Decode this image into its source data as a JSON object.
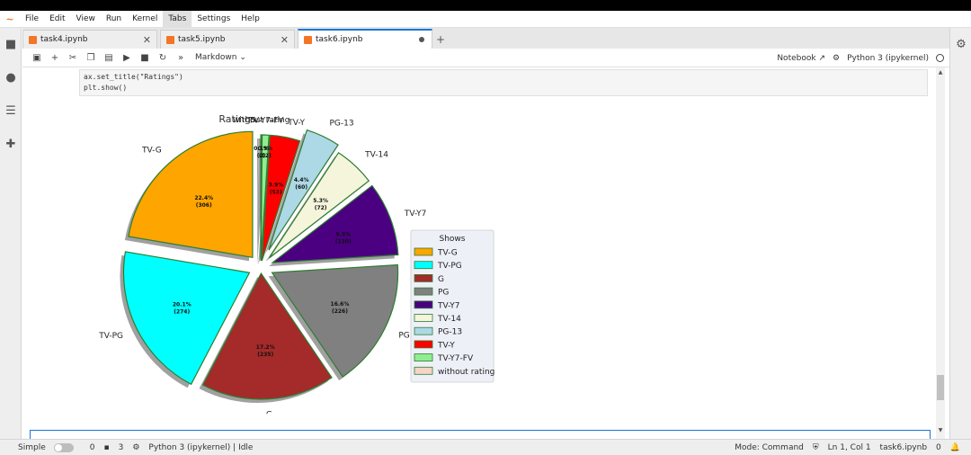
{
  "menu": [
    "File",
    "Edit",
    "View",
    "Run",
    "Kernel",
    "Tabs",
    "Settings",
    "Help"
  ],
  "tabs": [
    {
      "label": "task4.ipynb",
      "state": "close"
    },
    {
      "label": "task5.ipynb",
      "state": "close"
    },
    {
      "label": "task6.ipynb",
      "state": "dirty"
    }
  ],
  "toolbar": {
    "cell_type": "Markdown",
    "notebook_label": "Notebook",
    "kernel_label": "Python 3 (ipykernel)"
  },
  "code_lines": [
    "ax.set_title(\"Ratings\")",
    "plt.show()"
  ],
  "status": {
    "mode_label": "Simple",
    "count1": "0",
    "count2": "3",
    "kernel_status": "Python 3 (ipykernel) | Idle",
    "mode": "Mode: Command",
    "cursor": "Ln 1, Col 1",
    "file": "task6.ipynb",
    "notifications": "0"
  },
  "chart_data": {
    "type": "pie",
    "title": "Ratings",
    "legend_title": "Shows",
    "legend_position": "right",
    "slices": [
      {
        "label": "TV-G",
        "percent": "22.4%",
        "count": "(306)",
        "value": 306,
        "color": "#ffa500"
      },
      {
        "label": "TV-PG",
        "percent": "20.1%",
        "count": "(274)",
        "value": 274,
        "color": "#00ffff"
      },
      {
        "label": "G",
        "percent": "17.2%",
        "count": "(235)",
        "value": 235,
        "color": "#a52a2a"
      },
      {
        "label": "PG",
        "percent": "16.6%",
        "count": "(226)",
        "value": 226,
        "color": "#808080"
      },
      {
        "label": "TV-Y7",
        "percent": "9.5%",
        "count": "(130)",
        "value": 130,
        "color": "#4b0082"
      },
      {
        "label": "TV-14",
        "percent": "5.3%",
        "count": "(72)",
        "value": 72,
        "color": "#f5f5dc"
      },
      {
        "label": "PG-13",
        "percent": "4.4%",
        "count": "(60)",
        "value": 60,
        "color": "#add8e6"
      },
      {
        "label": "TV-Y",
        "percent": "3.9%",
        "count": "(53)",
        "value": 53,
        "color": "#ff0000"
      },
      {
        "label": "TV-Y7-FV",
        "percent": "0.9%",
        "count": "(12)",
        "value": 12,
        "color": "#90ee90"
      },
      {
        "label": "without rating",
        "percent": "0.1%",
        "count": "(2)",
        "value": 2,
        "color": "#f5d5c5"
      }
    ]
  }
}
